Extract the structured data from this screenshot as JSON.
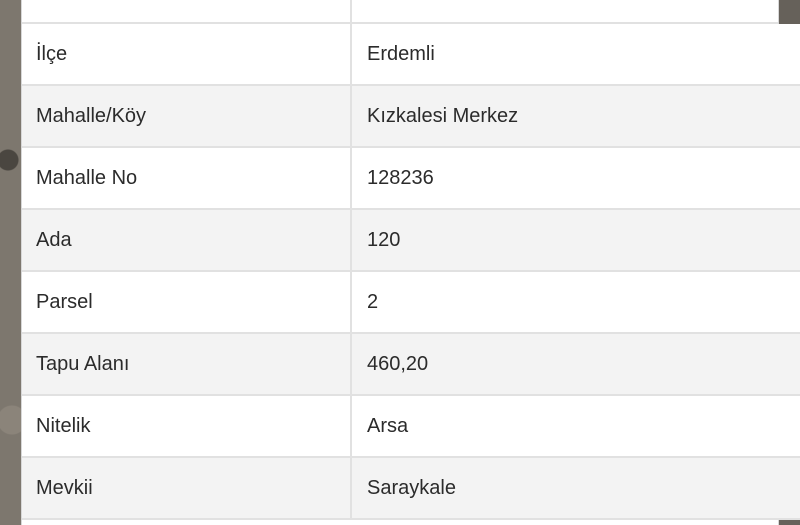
{
  "table": {
    "partial_value": "",
    "rows": [
      {
        "label": "İlçe",
        "value": "Erdemli"
      },
      {
        "label": "Mahalle/Köy",
        "value": "Kızkalesi Merkez"
      },
      {
        "label": "Mahalle No",
        "value": "128236"
      },
      {
        "label": "Ada",
        "value": "120"
      },
      {
        "label": "Parsel",
        "value": "2"
      },
      {
        "label": "Tapu Alanı",
        "value": "460,20"
      },
      {
        "label": "Nitelik",
        "value": "Arsa"
      },
      {
        "label": "Mevkii",
        "value": "Saraykale"
      }
    ]
  },
  "watermark": ""
}
